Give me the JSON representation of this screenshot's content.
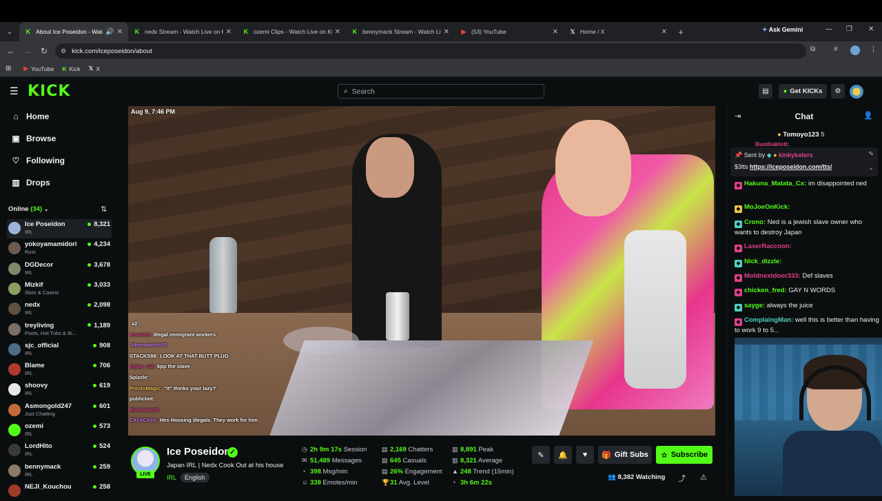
{
  "browser": {
    "tabs": [
      {
        "label": "About Ice Poseidon - Watch",
        "icon": "kick-icon",
        "active": true
      },
      {
        "label": "nedx Stream - Watch Live on Ki",
        "icon": "kick-icon"
      },
      {
        "label": "ozemi Clips - Watch Live on Ki",
        "icon": "kick-icon"
      },
      {
        "label": "bennymack Stream - Watch Liv",
        "icon": "kick-icon"
      },
      {
        "label": "(53) YouTube",
        "icon": "youtube-icon"
      },
      {
        "label": "Home / X",
        "icon": "x-icon"
      }
    ],
    "gemini_label": "Ask Gemini",
    "url": "kick.com/iceposeidon/about",
    "bookmarks": [
      "YouTube",
      "Kick",
      "X"
    ]
  },
  "kick": {
    "logo": "KICK",
    "search_placeholder": "Search",
    "get_kicks": "Get KICKs"
  },
  "sidebar": {
    "nav": [
      {
        "label": "Home",
        "icon": "home-icon"
      },
      {
        "label": "Browse",
        "icon": "browse-icon"
      },
      {
        "label": "Following",
        "icon": "heart-icon"
      },
      {
        "label": "Drops",
        "icon": "drops-icon"
      }
    ],
    "online_label": "Online",
    "online_count": "(34)",
    "channels": [
      {
        "name": "Ice Poseidon",
        "category": "IRL",
        "viewers": "8,321",
        "color": "#9db5d8"
      },
      {
        "name": "yokoyamamidori",
        "category": "Rust",
        "viewers": "4,234",
        "color": "#6b5b4d"
      },
      {
        "name": "DGDecor",
        "category": "IRL",
        "viewers": "3,678",
        "color": "#7c8a6a"
      },
      {
        "name": "Mizkif",
        "category": "Slots & Casino",
        "viewers": "3,033",
        "color": "#8aa060"
      },
      {
        "name": "nedx",
        "category": "IRL",
        "viewers": "2,098",
        "color": "#5e5040"
      },
      {
        "name": "treyliving",
        "category": "Pools, Hot Tubs & Bi...",
        "viewers": "1,189",
        "color": "#7b6e63"
      },
      {
        "name": "sjc_official",
        "category": "IRL",
        "viewers": "908",
        "color": "#4b6d8a"
      },
      {
        "name": "Blame",
        "category": "IRL",
        "viewers": "706",
        "color": "#b03a2e"
      },
      {
        "name": "shoovy",
        "category": "IRL",
        "viewers": "619",
        "color": "#e8e8e8"
      },
      {
        "name": "Asmongold247",
        "category": "Just Chatting",
        "viewers": "601",
        "color": "#c46a3c"
      },
      {
        "name": "ozemi",
        "category": "IRL",
        "viewers": "573",
        "color": "#53fc18"
      },
      {
        "name": "LordHito",
        "category": "IRL",
        "viewers": "524",
        "color": "#3a3a3a"
      },
      {
        "name": "bennymack",
        "category": "IRL",
        "viewers": "259",
        "color": "#8c7a66"
      },
      {
        "name": "NEJI_Kouchou",
        "category": "",
        "viewers": "258",
        "color": "#a03d2a"
      }
    ]
  },
  "video": {
    "timestamp": "Aug 9, 7:46 PM",
    "overlay_chat": [
      {
        "user": "",
        "text": "x2"
      },
      {
        "user": "arsonist:",
        "text": "illegal immigrant workers"
      },
      {
        "user": "JHemsworth05:",
        "text": ""
      },
      {
        "user": "STACKS88:",
        "text": "LOOK AT THAT BUTT PLUG"
      },
      {
        "user": "Dylan_G2:",
        "text": "kpp the slave"
      },
      {
        "user": "Spizzle:",
        "text": ""
      },
      {
        "user": "PrestoMagic:",
        "text": "\"it\" thinks your lazy?"
      },
      {
        "user": "publicbot:",
        "text": ""
      },
      {
        "user": "Bumbaklott:",
        "text": ""
      },
      {
        "user": "CXcXCXcx:",
        "text": "Hes Housing illegals. They work for him"
      }
    ]
  },
  "stream": {
    "name": "Ice Poseidon",
    "title": "Japan IRL | Nedx Cook Out at his house",
    "category": "IRL",
    "language": "English",
    "live_badge": "LIVE",
    "stats": [
      {
        "value": "2h 9m 17s",
        "label": "Session",
        "icon": "clock-icon"
      },
      {
        "value": "51,489",
        "label": "Messages",
        "icon": "messages-icon"
      },
      {
        "value": "398",
        "label": "Msg/min",
        "icon": "speed-icon"
      },
      {
        "value": "338",
        "label": "Emotes/min",
        "icon": "emote-icon"
      },
      {
        "value": "2,169",
        "label": "Chatters",
        "icon": "chatters-icon"
      },
      {
        "value": "645",
        "label": "Casuals",
        "icon": "casuals-icon"
      },
      {
        "value": "26%",
        "label": "Engagement",
        "icon": "engagement-icon"
      },
      {
        "value": "31",
        "label": "Avg. Level",
        "icon": "trophy-icon"
      },
      {
        "value": "8,891",
        "label": "Peak",
        "icon": "peak-icon"
      },
      {
        "value": "8,321",
        "label": "Average",
        "icon": "average-icon"
      },
      {
        "value": "248",
        "label": "Trend (15min)",
        "icon": "trend-up-icon"
      },
      {
        "value": "3h 6m 22s",
        "label": "",
        "icon": "timer-icon"
      }
    ],
    "gift_subs": "Gift Subs",
    "subscribe": "Subscribe",
    "watching": "8,382 Watching"
  },
  "chat": {
    "title": "Chat",
    "top_user": "Tomoyo123",
    "top_user_count": "5",
    "pinned_sent_by": "Sent by",
    "pinned_user": "kinkykaters",
    "pinned_text": "$3tts",
    "pinned_link": "https://iceposeidon.com/tts/",
    "hidden_user": "Bumbaklott:",
    "messages": [
      {
        "user": "Hakuna_Matata_Cx:",
        "text": "im disappointed ned",
        "color": "#53fc18",
        "badge": "#e0408a"
      },
      {
        "user": "MoJoeOnKick:",
        "text": "",
        "color": "#53fc18",
        "badge": "#e8c24a"
      },
      {
        "user": "Crono:",
        "text": "Ned is a jewish slave owner who wants to destroy Japan",
        "color": "#53fc18",
        "badge": "#4fd0c0"
      },
      {
        "user": "LaserRaccoon:",
        "text": "",
        "color": "#e0408a",
        "badge": "#e0408a"
      },
      {
        "user": "Nick_dizzle:",
        "text": "",
        "color": "#53fc18",
        "badge": "#4fd0c0"
      },
      {
        "user": "Moldnextdoor333:",
        "text": "Def slaves",
        "color": "#e0408a",
        "badge": "#e0408a"
      },
      {
        "user": "chicken_fred:",
        "text": "GAY N WORDS",
        "color": "#53fc18",
        "badge": "#e0408a"
      },
      {
        "user": "sayge:",
        "text": "always the juice",
        "color": "#53fc18",
        "badge": "#4fd0c0"
      },
      {
        "user": "ComplaingMan:",
        "text": "well this is better than having to work 9 to 5...",
        "color": "#4fd0c0",
        "badge": "#e0408a"
      }
    ]
  }
}
